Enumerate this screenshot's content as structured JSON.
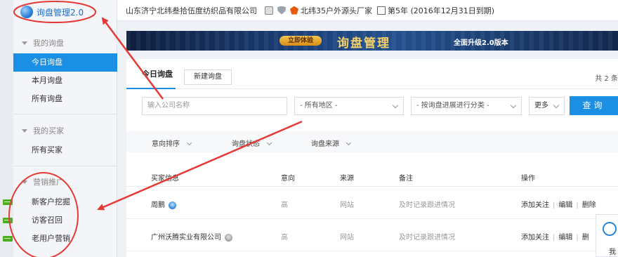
{
  "sidebar": {
    "logo_text": "询盘管理2.0",
    "sections": [
      {
        "title": "我的询盘",
        "items": [
          "今日询盘",
          "本月询盘",
          "所有询盘"
        ]
      },
      {
        "title": "我的买家",
        "items": [
          "所有买家"
        ]
      },
      {
        "title": "营销推广",
        "items": [
          "新客户挖掘",
          "访客召回",
          "老用户营销"
        ]
      }
    ]
  },
  "topbar": {
    "company": "山东济宁北纬叁拾伍度纺织品有限公司",
    "badge_text": "北纬35户外源头厂家",
    "years_text": "第5年 (2016年12月31日到期)"
  },
  "banner": {
    "pill": "立即体验",
    "title": "询盘管理",
    "subtitle": "全面升级2.0版本"
  },
  "panel": {
    "tab_today": "今日询盘",
    "new_button": "新建询盘",
    "total_text": "共 2 条",
    "search": {
      "company_placeholder": "输入公司名称",
      "region": "- 所有地区 -",
      "progress": "- 按询盘进展进行分类 -",
      "more": "更多",
      "query": "查询"
    },
    "filters": [
      "意向排序",
      "询盘状态",
      "询盘来源"
    ],
    "columns": [
      "买家信息",
      "意向",
      "来源",
      "备注",
      "操作"
    ],
    "rows": [
      {
        "buyer": "周鹏",
        "intent": "高",
        "source": "网站",
        "note": "及时记录跟进情况",
        "ops": [
          "添加关注",
          "编辑",
          "删除"
        ]
      },
      {
        "buyer": "广州沃腾实业有限公司",
        "intent": "高",
        "source": "网站",
        "note": "及时记录跟进情况",
        "ops": [
          "添加关注",
          "编辑",
          "删"
        ]
      }
    ]
  },
  "float_card": {
    "text": "我的"
  },
  "colors": {
    "accent": "#1a8fe3",
    "annotation": "#e53935"
  }
}
